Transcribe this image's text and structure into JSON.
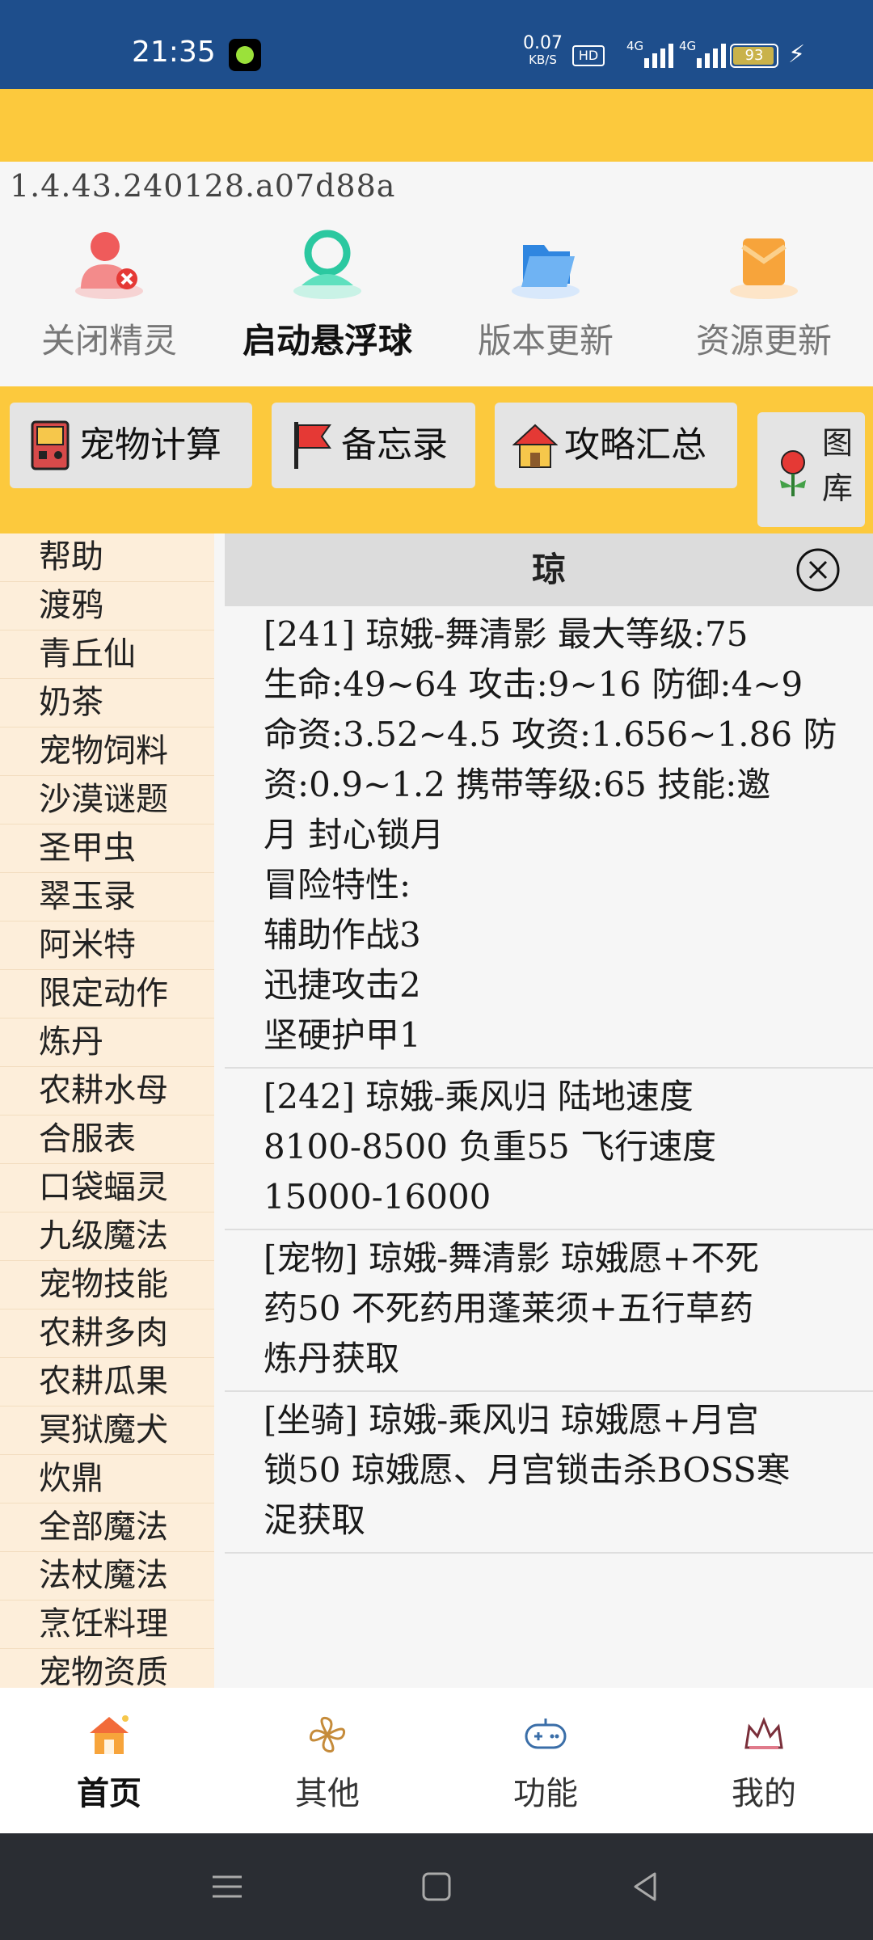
{
  "status_bar": {
    "time": "21:35",
    "speed_value": "0.07",
    "speed_unit": "KB/S",
    "hd_label": "HD",
    "net1": "4G",
    "net2": "4G",
    "battery": "93"
  },
  "version": "1.4.43.240128.a07d88a",
  "top_actions": [
    {
      "label": "关闭精灵",
      "icon": "user-close-icon"
    },
    {
      "label": "启动悬浮球",
      "icon": "floating-ball-icon"
    },
    {
      "label": "版本更新",
      "icon": "folder-icon"
    },
    {
      "label": "资源更新",
      "icon": "package-icon"
    }
  ],
  "tool_buttons": [
    {
      "label": "宠物计算",
      "icon": "gameboy-icon"
    },
    {
      "label": "备忘录",
      "icon": "flag-icon"
    },
    {
      "label": "攻略汇总",
      "icon": "house-icon"
    },
    {
      "label": "图库",
      "icon": "flower-icon"
    }
  ],
  "sidebar": {
    "items": [
      "帮助",
      "渡鸦",
      "青丘仙",
      "奶茶",
      "宠物饲料",
      "沙漠谜题",
      "圣甲虫",
      "翠玉录",
      "阿米特",
      "限定动作",
      "炼丹",
      "农耕水母",
      "合服表",
      "口袋蝠灵",
      "九级魔法",
      "宠物技能",
      "农耕多肉",
      "农耕瓜果",
      "冥狱魔犬",
      "炊鼎",
      "全部魔法",
      "法杖魔法",
      "烹饪料理",
      "宠物资质"
    ]
  },
  "panel": {
    "title": "琼",
    "entries": [
      {
        "lines": [
          "[241] 琼娥-舞清影 最大等级:75",
          "生命:49~64 攻击:9~16 防御:4~9",
          "命资:3.52~4.5 攻资:1.656~1.86 防",
          "资:0.9~1.2    携带等级:65  技能:邀",
          "月 封心锁月",
          "冒险特性:",
          "辅助作战3",
          "迅捷攻击2",
          "坚硬护甲1"
        ]
      },
      {
        "lines": [
          "[242] 琼娥-乘风归 陆地速度",
          "8100-8500 负重55 飞行速度",
          "15000-16000"
        ]
      },
      {
        "lines": [
          "[宠物] 琼娥-舞清影 琼娥愿+不死",
          "药50 不死药用蓬莱须+五行草药",
          "炼丹获取"
        ]
      },
      {
        "lines": [
          "[坐骑] 琼娥-乘风归 琼娥愿+月宫",
          "锁50 琼娥愿、月宫锁击杀BOSS寒",
          "浞获取"
        ]
      }
    ]
  },
  "bottom_nav": [
    {
      "label": "首页",
      "icon": "home-icon",
      "active": true
    },
    {
      "label": "其他",
      "icon": "pinwheel-icon",
      "active": false
    },
    {
      "label": "功能",
      "icon": "gamepad-icon",
      "active": false
    },
    {
      "label": "我的",
      "icon": "crown-icon",
      "active": false
    }
  ],
  "colors": {
    "status_bar": "#1e4e8c",
    "accent_yellow": "#fcc93d",
    "sidebar_bg": "#fdeeda",
    "panel_header": "#dcdcdc"
  }
}
